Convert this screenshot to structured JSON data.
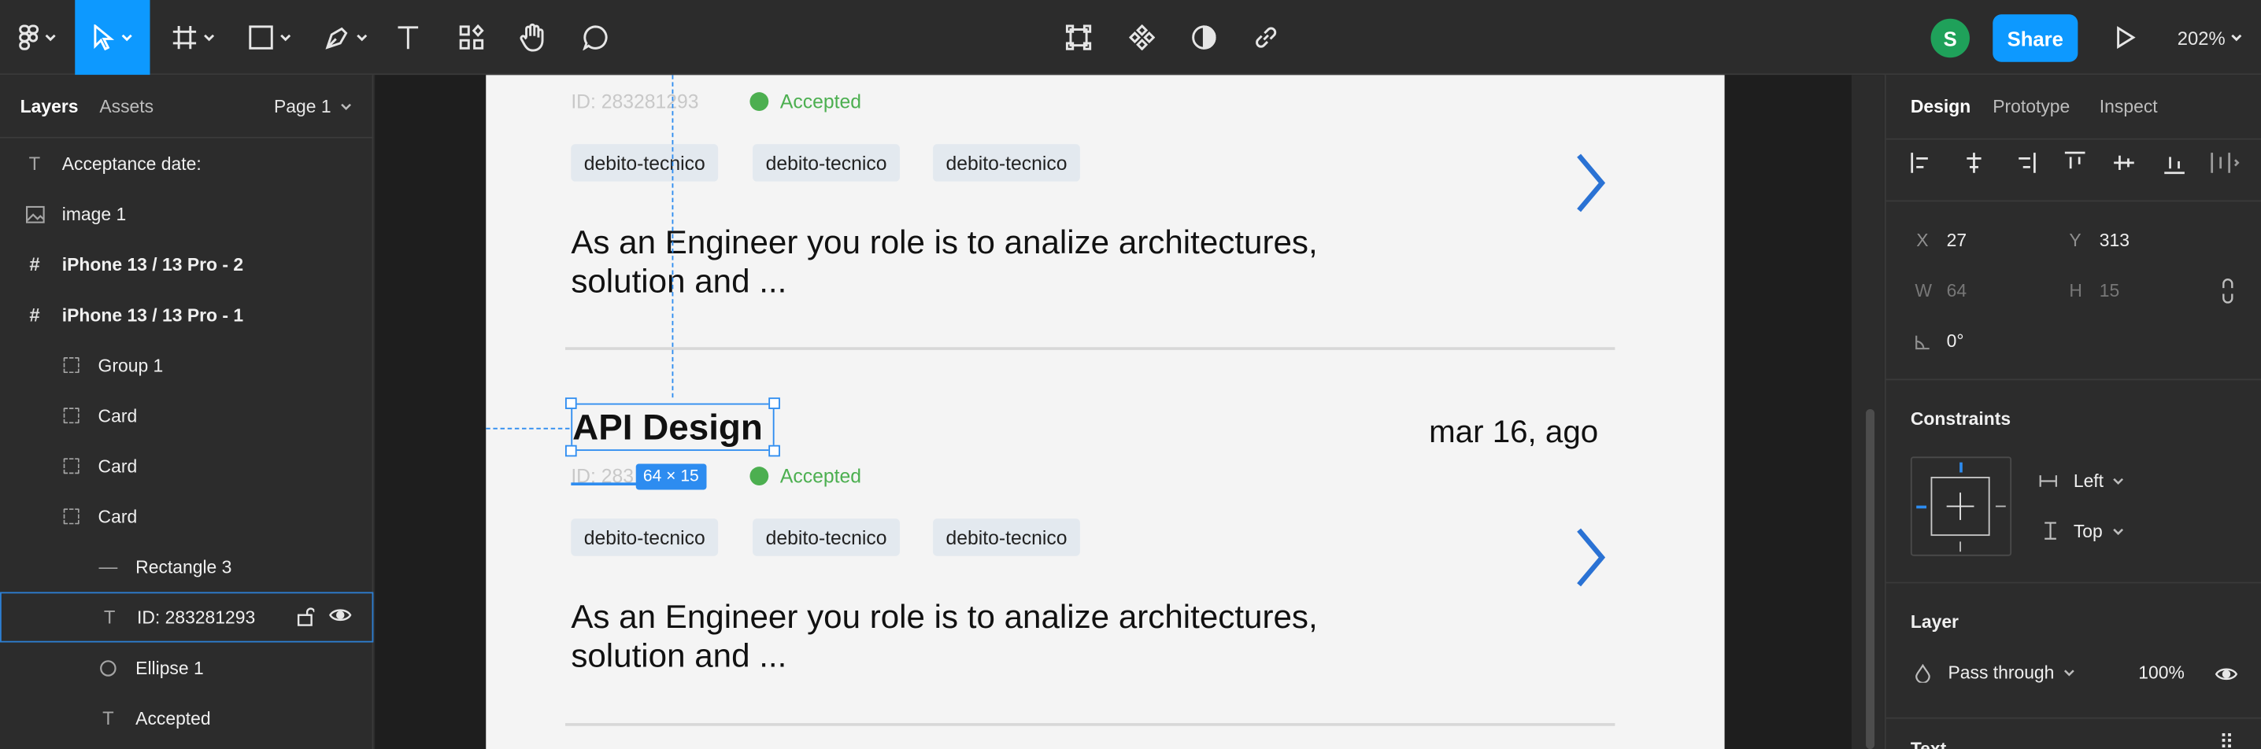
{
  "toolbar": {
    "avatar_initial": "S",
    "share_label": "Share",
    "zoom_label": "202%"
  },
  "left_panel": {
    "tabs": {
      "layers": "Layers",
      "assets": "Assets",
      "page": "Page 1"
    },
    "layers": [
      {
        "label": "Acceptance date:",
        "icon": "text-icon",
        "bold": false
      },
      {
        "label": "image 1",
        "icon": "image-icon",
        "bold": false
      },
      {
        "label": "iPhone 13 / 13 Pro - 2",
        "icon": "frame-icon",
        "bold": true
      },
      {
        "label": "iPhone 13 / 13 Pro - 1",
        "icon": "frame-icon",
        "bold": true
      },
      {
        "label": "Group 1",
        "icon": "group-icon",
        "bold": false
      },
      {
        "label": "Card",
        "icon": "group-icon",
        "bold": false
      },
      {
        "label": "Card",
        "icon": "group-icon",
        "bold": false
      },
      {
        "label": "Card",
        "icon": "group-icon",
        "bold": false
      },
      {
        "label": "Rectangle 3",
        "icon": "line-icon",
        "bold": false
      },
      {
        "label": "ID: 283281293",
        "icon": "text-icon",
        "bold": false,
        "selected": true
      },
      {
        "label": "Ellipse 1",
        "icon": "ellipse-icon",
        "bold": false
      },
      {
        "label": "Accepted",
        "icon": "text-icon",
        "bold": false
      }
    ]
  },
  "canvas": {
    "card_top": {
      "id_text": "ID: 283281293",
      "status": "Accepted",
      "tags": [
        "debito-tecnico",
        "debito-tecnico",
        "debito-tecnico"
      ],
      "description_line1": "As an Engineer you role is to analize architectures,",
      "description_line2": "solution and ..."
    },
    "card_selected": {
      "title": "API Design",
      "date": "mar 16, ago",
      "id_text": "ID: 283",
      "dimension_badge": "64 × 15",
      "status": "Accepted",
      "tags": [
        "debito-tecnico",
        "debito-tecnico",
        "debito-tecnico"
      ],
      "description_line1": "As an Engineer you role is to analize architectures,",
      "description_line2": "solution and ..."
    },
    "colors": {
      "accent": "#2a72d4",
      "status_green": "#4caf50",
      "selection": "#2d8cf0"
    }
  },
  "right_panel": {
    "tabs": {
      "design": "Design",
      "prototype": "Prototype",
      "inspect": "Inspect"
    },
    "position": {
      "x_label": "X",
      "x_value": "27",
      "y_label": "Y",
      "y_value": "313"
    },
    "size": {
      "w_label": "W",
      "w_value": "64",
      "h_label": "H",
      "h_value": "15"
    },
    "rotation": "0°",
    "constraints": {
      "title": "Constraints",
      "horizontal": "Left",
      "vertical": "Top"
    },
    "layer": {
      "title": "Layer",
      "blend": "Pass through",
      "opacity": "100%"
    },
    "text": {
      "title": "Text"
    }
  }
}
